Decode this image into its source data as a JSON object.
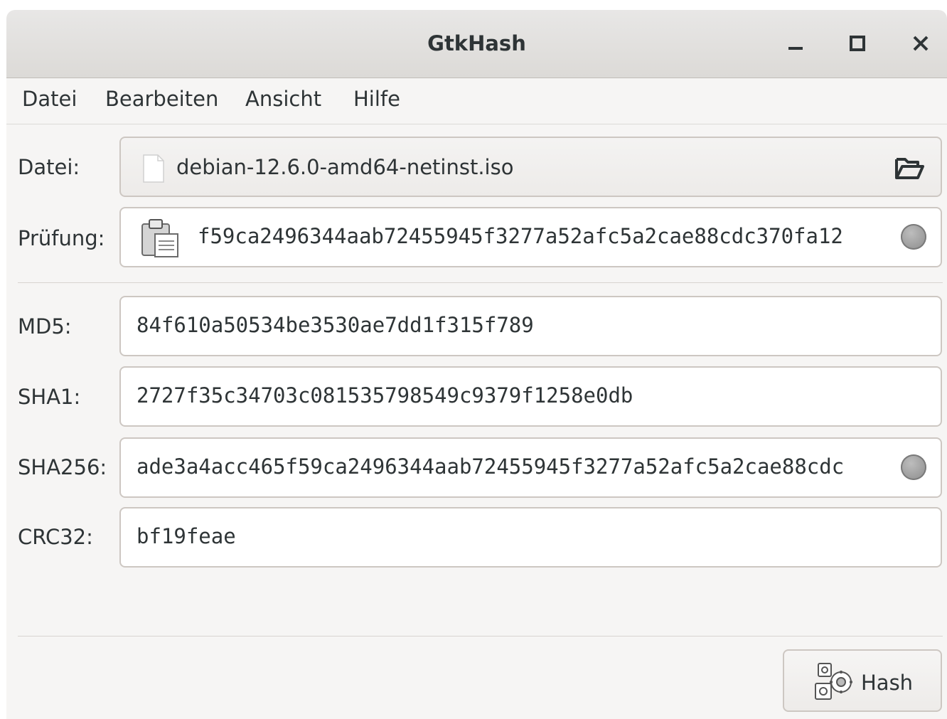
{
  "window": {
    "title": "GtkHash"
  },
  "menubar": {
    "items": [
      "Datei",
      "Bearbeiten",
      "Ansicht",
      "Hilfe"
    ]
  },
  "file": {
    "label": "Datei:",
    "filename": "debian-12.6.0-amd64-netinst.iso",
    "open_icon": "folder-open-icon"
  },
  "check": {
    "label": "Prüfung:",
    "value": "f59ca2496344aab72455945f3277a52afc5a2cae88cdc370fa12",
    "paste_icon": "clipboard-paste-icon"
  },
  "hashes": [
    {
      "label": "MD5:",
      "value": "84f610a50534be3530ae7dd1f315f789",
      "indicator": false
    },
    {
      "label": "SHA1:",
      "value": "2727f35c34703c081535798549c9379f1258e0db",
      "indicator": false
    },
    {
      "label": "SHA256:",
      "value": "ade3a4acc465f59ca2496344aab72455945f3277a52afc5a2cae88cdc",
      "indicator": true
    },
    {
      "label": "CRC32:",
      "value": "bf19feae",
      "indicator": false
    }
  ],
  "actions": {
    "hash_label": "Hash"
  },
  "colors": {
    "text": "#2e3436",
    "window_bg": "#f6f5f4",
    "border": "#cdc7c2",
    "indicator": "#a0a0a0"
  }
}
